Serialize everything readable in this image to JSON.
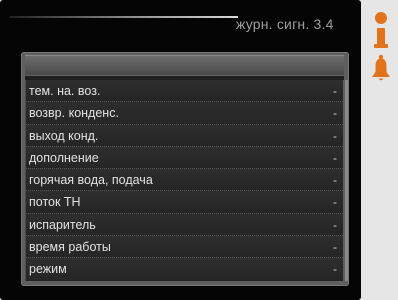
{
  "header": {
    "title": "журн. сигн. 3.4"
  },
  "list": {
    "items": [
      {
        "label": "тем. на. воз.",
        "value": "-"
      },
      {
        "label": "возвр. конденс.",
        "value": "-"
      },
      {
        "label": "выход конд.",
        "value": "-"
      },
      {
        "label": "дополнение",
        "value": "-"
      },
      {
        "label": "горячая вода, подача",
        "value": "-"
      },
      {
        "label": "поток ТН",
        "value": "-"
      },
      {
        "label": "испаритель",
        "value": "-"
      },
      {
        "label": "время работы",
        "value": "-"
      },
      {
        "label": "режим",
        "value": "-"
      }
    ]
  },
  "icons": {
    "info": "info-icon",
    "alarm": "alarm-bell-icon"
  },
  "colors": {
    "screen_bg": "#050505",
    "accent_orange": "#e0731c",
    "text": "#e2e2e2",
    "header_text": "#9d9d9d"
  }
}
